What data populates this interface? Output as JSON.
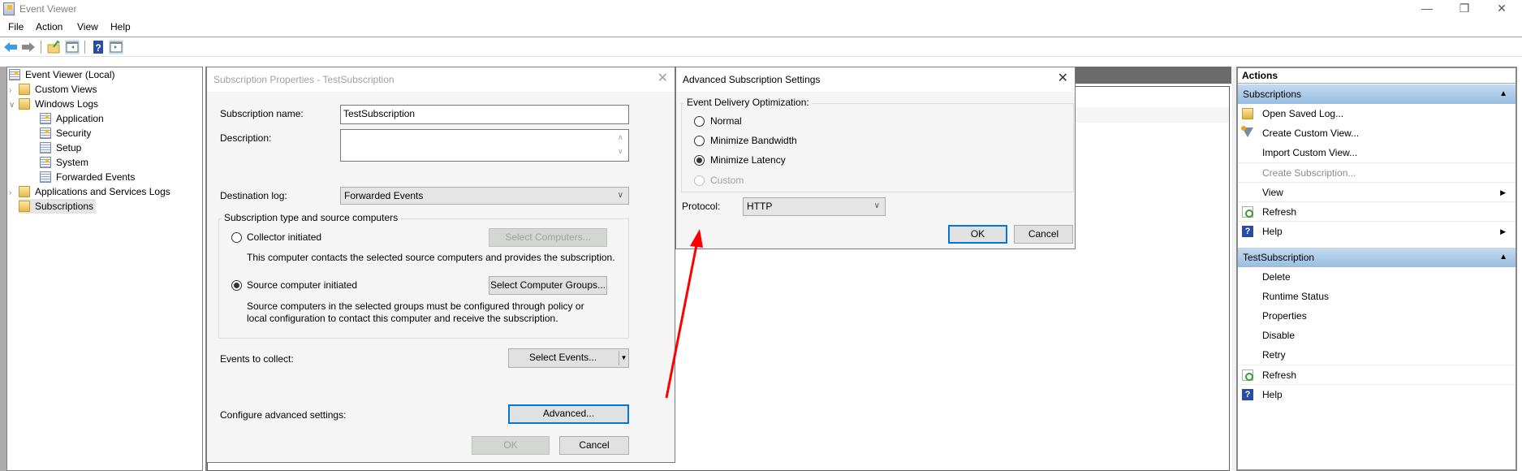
{
  "window": {
    "title": "Event Viewer",
    "controls": {
      "minimize": "—",
      "restore": "❐",
      "close": "✕"
    }
  },
  "menubar": [
    "File",
    "Action",
    "View",
    "Help"
  ],
  "toolbar": {
    "icons": [
      "back-arrow-icon",
      "forward-arrow-icon",
      "up-folder-icon",
      "show-hide-console-tree-icon",
      "help-icon",
      "show-hide-action-pane-icon"
    ]
  },
  "tree": {
    "root": "Event Viewer (Local)",
    "items": [
      {
        "label": "Custom Views",
        "expander": ">",
        "level": 1
      },
      {
        "label": "Windows Logs",
        "expander": "v",
        "level": 1
      },
      {
        "label": "Application",
        "level": 2
      },
      {
        "label": "Security",
        "level": 2
      },
      {
        "label": "Setup",
        "level": 2
      },
      {
        "label": "System",
        "level": 2
      },
      {
        "label": "Forwarded Events",
        "level": 2
      },
      {
        "label": "Applications and Services Logs",
        "expander": ">",
        "level": 1
      },
      {
        "label": "Subscriptions",
        "level": 1,
        "selected": true
      }
    ]
  },
  "subscription_dialog": {
    "title": "Subscription Properties - TestSubscription",
    "name_label": "Subscription name:",
    "name_value": "TestSubscription",
    "description_label": "Description:",
    "description_value": "",
    "destination_label": "Destination log:",
    "destination_value": "Forwarded Events",
    "type_group": "Subscription type and source computers",
    "collector_label": "Collector initiated",
    "collector_button": "Select Computers...",
    "collector_desc": "This computer contacts the selected source computers and provides the subscription.",
    "source_label": "Source computer initiated",
    "source_button": "Select Computer Groups...",
    "source_desc_1": "Source computers in the selected groups must be configured through policy or",
    "source_desc_2": "local configuration to contact this computer and receive the subscription.",
    "selected_type": "Source computer initiated",
    "events_label": "Events to collect:",
    "events_button": "Select Events...",
    "advanced_label": "Configure advanced settings:",
    "advanced_button": "Advanced...",
    "ok": "OK",
    "cancel": "Cancel"
  },
  "advanced_dialog": {
    "title": "Advanced Subscription Settings",
    "group": "Event Delivery Optimization:",
    "options": [
      {
        "label": "Normal",
        "checked": false,
        "disabled": false
      },
      {
        "label": "Minimize Bandwidth",
        "checked": false,
        "disabled": false
      },
      {
        "label": "Minimize Latency",
        "checked": true,
        "disabled": false
      },
      {
        "label": "Custom",
        "checked": false,
        "disabled": true
      }
    ],
    "protocol_label": "Protocol:",
    "protocol_value": "HTTP",
    "ok": "OK",
    "cancel": "Cancel"
  },
  "actions": {
    "header": "Actions",
    "groups": [
      {
        "title": "Subscriptions",
        "items": [
          {
            "label": "Open Saved Log...",
            "icon": "open-folder-icon"
          },
          {
            "label": "Create Custom View...",
            "icon": "filter-icon"
          },
          {
            "label": "Import Custom View..."
          },
          {
            "label": "Create Subscription...",
            "disabled": true
          },
          {
            "label": "View",
            "submenu": true
          },
          {
            "label": "Refresh",
            "icon": "refresh-icon"
          },
          {
            "label": "Help",
            "icon": "help-icon",
            "submenu": true
          }
        ]
      },
      {
        "title": "TestSubscription",
        "items": [
          {
            "label": "Delete"
          },
          {
            "label": "Runtime Status"
          },
          {
            "label": "Properties"
          },
          {
            "label": "Disable"
          },
          {
            "label": "Retry"
          },
          {
            "label": "Refresh",
            "icon": "refresh-icon"
          },
          {
            "label": "Help",
            "icon": "help-icon"
          }
        ]
      }
    ]
  },
  "annotation": {
    "type": "red-arrow",
    "color": "#ff0000",
    "from": "advanced-button",
    "to": "advanced-subscription-settings-dialog"
  }
}
